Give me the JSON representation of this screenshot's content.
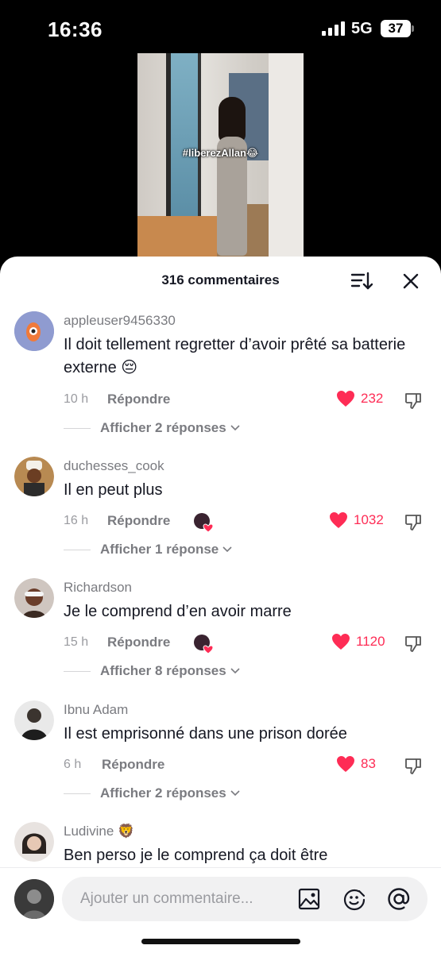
{
  "status_bar": {
    "time": "16:36",
    "network": "5G",
    "battery": "37"
  },
  "video": {
    "caption": "#liberezAllan😂"
  },
  "sheet": {
    "title": "316 commentaires"
  },
  "comments": [
    {
      "username": "appleuser9456330",
      "text": "Il doit tellement regretter d’avoir prêté sa batterie externe 😔",
      "time": "10 h",
      "reply_label": "Répondre",
      "likes": "232",
      "replies_label": "Afficher 2 réponses"
    },
    {
      "username": "duchesses_cook",
      "text": "Il en peut plus",
      "time": "16 h",
      "reply_label": "Répondre",
      "likes": "1032",
      "replies_label": "Afficher 1 réponse"
    },
    {
      "username": "Richardson",
      "text": "Je le comprend d’en avoir marre",
      "time": "15 h",
      "reply_label": "Répondre",
      "likes": "1120",
      "replies_label": "Afficher 8 réponses"
    },
    {
      "username": "Ibnu Adam",
      "text": "Il est emprisonné dans une prison dorée",
      "time": "6 h",
      "reply_label": "Répondre",
      "likes": "83",
      "replies_label": "Afficher 2 réponses"
    },
    {
      "username": "Ludivine 🦁",
      "text": "Ben perso je le comprend ça doit être"
    }
  ],
  "input": {
    "placeholder": "Ajouter un commentaire..."
  },
  "colors": {
    "like_red": "#fe2c55",
    "sheet_bg": "#ffffff",
    "text_primary": "#161823",
    "text_secondary": "#7a7b80"
  }
}
